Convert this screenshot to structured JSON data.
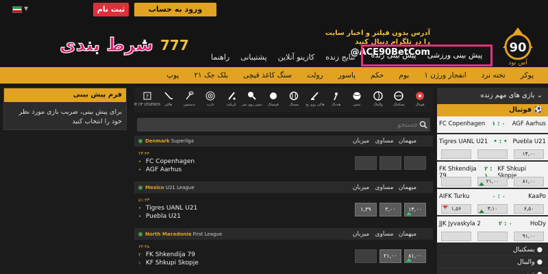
{
  "topbar": {
    "signup_label": "ثبت نام",
    "login_label": "ورود به حساب کاربری",
    "flag_colors": [
      "#239f40",
      "#ffffff",
      "#da0000"
    ]
  },
  "header": {
    "logo_text": "شرط بندی",
    "logo_prefix": "777",
    "promo_line1": "آدرس بدون فیلتر و اخبار سایت",
    "promo_line2": "را در تلگرام دنبال کنید",
    "promo_handle": "@ACE90BetCom",
    "brand_text": "آس نود",
    "brand_number": "90"
  },
  "nav": {
    "highlighted": [
      "پیش بینی ورزشی",
      "پیش بینی زنده"
    ],
    "items": [
      "نتایج زنده",
      "کازینو آنلاین",
      "پشتیبانی",
      "راهنما"
    ]
  },
  "categories": [
    "پوکر",
    "تخته نرد",
    "انفجار ورژن ۱",
    "بوم",
    "حکم",
    "پاسور",
    "رولت",
    "سنگ کاغذ قیچی",
    "بلک جک ۲۱",
    "پوپ"
  ],
  "bet_slip": {
    "title": "فرم پیش بینی",
    "body": "برای پیش بینی، ضریب بازی مورد نظر خود را انتخاب کنید"
  },
  "sports_bar": [
    {
      "label": "فوتبال",
      "icon": "football-icon"
    },
    {
      "label": "بسکتبال",
      "icon": "basketball-icon"
    },
    {
      "label": "والیبال",
      "icon": "volleyball-icon"
    },
    {
      "label": "تنیس",
      "icon": "tennis-icon"
    },
    {
      "label": "هندبال",
      "icon": "handball-icon"
    },
    {
      "label": "هاکی روی یخ",
      "icon": "ice-hockey-icon"
    },
    {
      "label": "بیسبال",
      "icon": "baseball-icon"
    },
    {
      "label": "فوتسال",
      "icon": "futsal-icon"
    },
    {
      "label": "تنیس روی میز",
      "icon": "table-tennis-icon"
    },
    {
      "label": "کریکت",
      "icon": "cricket-icon"
    },
    {
      "label": "دارت",
      "icon": "darts-icon"
    },
    {
      "label": "بدمینتون",
      "icon": "badminton-icon"
    },
    {
      "label": "هاکی",
      "icon": "field-hockey-icon"
    },
    {
      "label": "LEAGUE OF LEGENDS",
      "icon": "esports-icon"
    }
  ],
  "search": {
    "placeholder": "جستجو"
  },
  "column_heads": [
    "میهمان",
    "مساوی",
    "میزبان"
  ],
  "matches": [
    {
      "country": "Denmark",
      "league": "Superliga",
      "time": "۲۳:۴۴",
      "home": "FC Copenhagen",
      "away": "AGF Aarhus",
      "home_score": "",
      "away_score": "",
      "odds": [
        "",
        "",
        ""
      ]
    },
    {
      "country": "Mexico",
      "league": "U21 League",
      "time": "۵۱:۴۳",
      "home": "Tigres UANL U21",
      "away": "Puebla U21",
      "home_score": "",
      "away_score": "",
      "odds": [
        "۱۴,۰۰",
        "۳,۰۰",
        "۱,۳۹"
      ]
    },
    {
      "country": "North Macedonia",
      "league": "First League",
      "time": "۶۴:۴۵",
      "home": "FK Shkendija 79",
      "away": "KF Shkupi Skopje",
      "home_score": "۲",
      "away_score": "۱",
      "odds": [
        "۸۱,۰۰",
        "۲۱,۰۰",
        ""
      ]
    }
  ],
  "live_panel": {
    "title": "بازی های مهم زنده",
    "sport": "فوتبال",
    "matches": [
      {
        "left": "FC Copenhagen",
        "score": "۱ : ۰",
        "right": "AGF Aarhus",
        "odds": []
      },
      {
        "left": "Tigres UANL U21",
        "score": "• : •",
        "right": "Puebla U21",
        "odds": [
          "",
          "",
          "۱۴,۰۰"
        ]
      },
      {
        "left": "FK Shkendija 79",
        "score": "۲ : ۱",
        "right": "KF Shkupi Skopje",
        "odds": [
          "",
          "۲۱,۰۰",
          "۸۱,۰۰"
        ]
      },
      {
        "left": "AIFK Turku",
        "score": "۰ : ۰",
        "right": "KaaPo",
        "odds": [
          "۱,۵۶",
          "۳,۱۰",
          "۶,۵۰"
        ]
      },
      {
        "left": "JJK Jyvaskyla 2",
        "score": "۲ : ۰",
        "right": "HoDy",
        "odds": [
          "",
          "",
          "۹۱,۰۰"
        ]
      }
    ],
    "other_sports": [
      "بسکتبال",
      "والیبال",
      "تنیس"
    ]
  }
}
